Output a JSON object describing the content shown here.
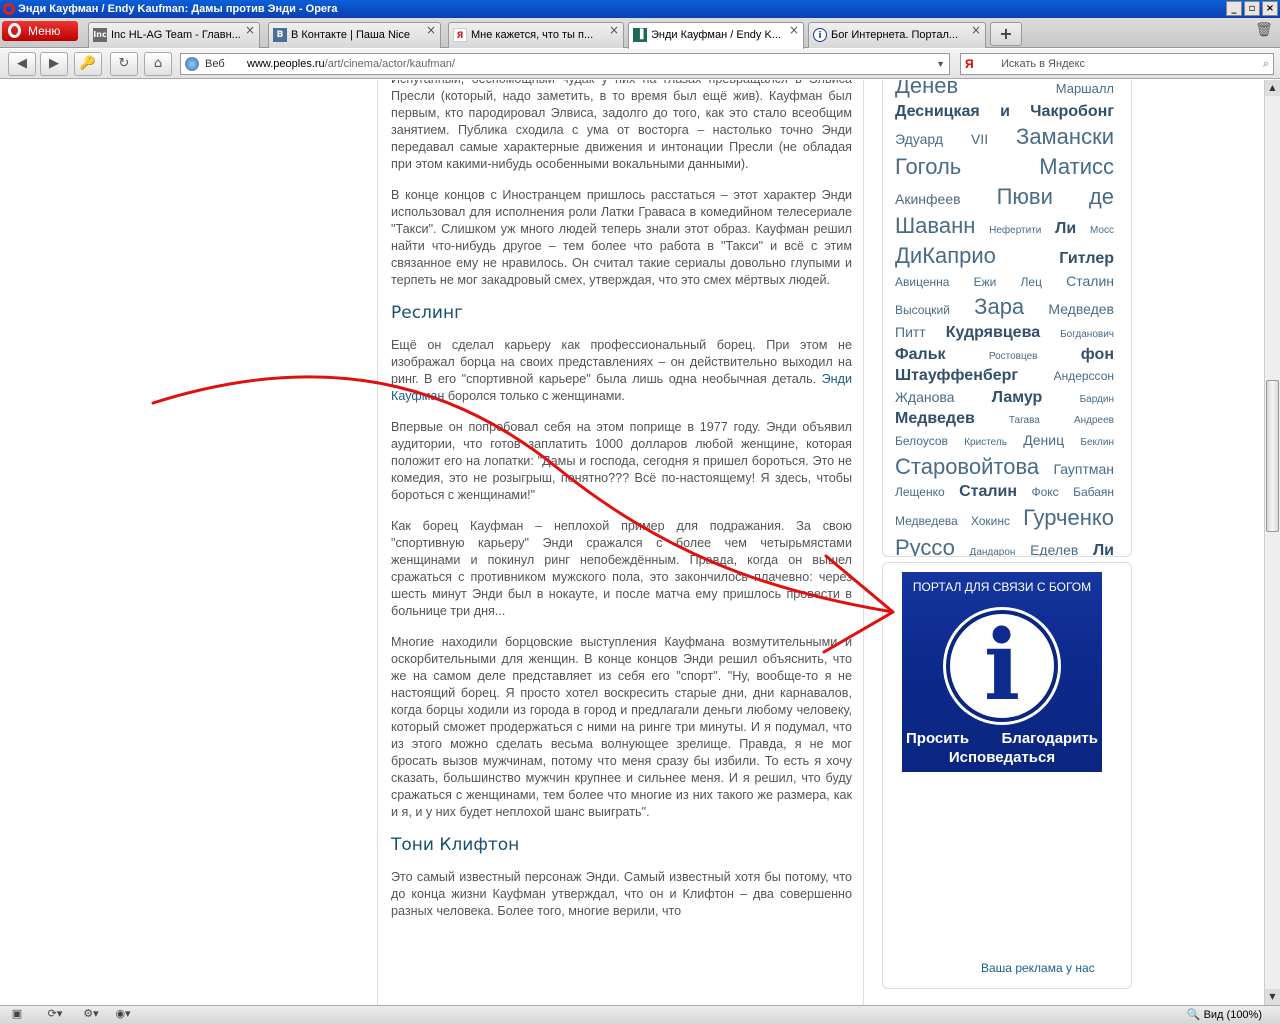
{
  "window": {
    "title": "Энди Кауфман / Endy Kaufman: Дамы против Энди - Opera",
    "min": "_",
    "restore": "▫",
    "close": "×"
  },
  "menu": {
    "label": "Меню"
  },
  "tabs": [
    {
      "icon": "Inc",
      "label": "Inc HL-AG Team - Главн...",
      "color": "#6a6a6a"
    },
    {
      "icon": "B",
      "label": "В Контакте | Паша Nice",
      "color": "#4a6f9a"
    },
    {
      "icon": "Я",
      "label": "Мне кажется, что ты п...",
      "color": "#cc2222"
    },
    {
      "icon": "▐",
      "label": "Энди Кауфман / Endy K...",
      "color": "#1e6a5a",
      "active": true
    },
    {
      "icon": "i",
      "label": "Бог Интернета. Портал...",
      "color": "#1a3a9a"
    }
  ],
  "newtab": "+",
  "nav": {
    "back": "◀",
    "forward": "▶",
    "wand": "🔑",
    "reload": "↻",
    "home": "⌂"
  },
  "address": {
    "web": "Веб",
    "domain": "www.peoples.ru",
    "path": "/art/cinema/actor/kaufman/"
  },
  "search": {
    "engine": "Я",
    "placeholder": "Искать в Яндекс"
  },
  "article": {
    "p0": "Испуганный, беспомощный чудак у них на глазах превращался в Элвиса Пресли (который, надо заметить, в то время был ещё жив). Кауфман был первым, кто пародировал Элвиса, задолго до того, как это стало всеобщим занятием. Публика сходила с ума от восторга – настолько точно Энди передавал самые характерные движения и интонации Пресли (не обладая при этом какими-нибудь особенными вокальными данными).",
    "p1": "В конце концов с Иностранцем пришлось расстаться – этот характер Энди использовал для исполнения роли Латки Граваса в комедийном телесериале \"Такси\". Слишком уж много людей теперь знали этот образ. Кауфман решил найти что-нибудь другое – тем более что работа в \"Такси\" и всё с этим связанное ему не нравилось. Он считал такие сериалы довольно глупыми и терпеть не мог закадровый смех, утверждая, что это смех мёртвых людей.",
    "h1": "Реслинг",
    "p2a": "Ещё он сделал карьеру как профессиональный борец. При этом не изображал борца на своих представлениях – он действительно выходил на ринг. В его \"спортивной карьере\" была лишь одна необычная деталь. ",
    "p2link": "Энди Кауфман",
    "p2b": " боролся только с женщинами.",
    "p3": "Впервые он попробовал себя на этом поприще в 1977 году. Энди объявил аудитории, что готов заплатить 1000 долларов любой женщине, которая положит его на лопатки: \"Дамы и господа, сегодня я пришел бороться. Это не комедия, это не розыгрыш, понятно??? Всё по-настоящему! Я здесь, чтобы бороться с женщинами!\"",
    "p4": "Как борец Кауфман – неплохой пример для подражания. За свою \"спортивную карьеру\" Энди сражался с более чем четырьмястами женщинами и покинул ринг непобеждённым. Правда, когда он вышел сражаться с противником мужского пола, это закончилось плачевно: через шесть минут Энди был в нокауте, и после матча ему пришлось провести в больнице три дня...",
    "p5": "Многие находили борцовские выступления Кауфмана возмутительными и оскорбительными для женщин. В конце концов Энди решил объяснить, что же на самом деле представляет из себя его \"спорт\". \"Ну, вообще-то я не настоящий борец. Я просто хотел воскресить старые дни, дни карнавалов, когда борцы ходили из города в город и предлагали деньги любому человеку, который сможет продержаться с ними на ринге три минуты. И я подумал, что из этого можно сделать весьма волнующее зрелище. Правда, я не мог бросать вызов мужчинам, потому что меня сразу бы избили. То есть я хочу сказать, большинство мужчин крупнее и сильнее меня. И я решил, что буду сражаться с женщинами, тем более что многие из них такого же размера, как и я, и у них будет неплохой шанс выиграть\".",
    "h2": "Тони Клифтон",
    "p6": "Это самый известный персонаж Энди. Самый известный хотя бы потому, что до конца жизни Кауфман утверждал, что он и Клифтон – два совершенно разных человека. Более того, многие верили, что"
  },
  "tags": [
    {
      "t": "Денев",
      "s": 22
    },
    {
      "t": "Маршалл",
      "s": 13
    },
    {
      "t": "Десницкая",
      "s": 16,
      "b": true
    },
    {
      "t": "и",
      "s": 16,
      "b": true
    },
    {
      "t": "Чакробонг",
      "s": 16,
      "b": true
    },
    {
      "t": "Эдуард",
      "s": 14
    },
    {
      "t": "VII",
      "s": 14
    },
    {
      "t": "Замански",
      "s": 22
    },
    {
      "t": "Гоголь",
      "s": 22
    },
    {
      "t": "Матисс",
      "s": 22
    },
    {
      "t": "Акинфеев",
      "s": 14
    },
    {
      "t": "Пюви",
      "s": 22
    },
    {
      "t": "де",
      "s": 22
    },
    {
      "t": "Шаванн",
      "s": 22
    },
    {
      "t": "Нефертити",
      "s": 10
    },
    {
      "t": "Ли",
      "s": 16,
      "b": true
    },
    {
      "t": "Мосс",
      "s": 10
    },
    {
      "t": "ДиКаприо",
      "s": 22
    },
    {
      "t": "Гитлер",
      "s": 16,
      "b": true
    },
    {
      "t": "Авиценна",
      "s": 12
    },
    {
      "t": "Ежи",
      "s": 12
    },
    {
      "t": "Лец",
      "s": 12
    },
    {
      "t": "Сталин",
      "s": 14
    },
    {
      "t": "Высоцкий",
      "s": 12
    },
    {
      "t": "Зара",
      "s": 22
    },
    {
      "t": "Медведев",
      "s": 14
    },
    {
      "t": "Питт",
      "s": 14
    },
    {
      "t": "Кудрявцева",
      "s": 16,
      "b": true
    },
    {
      "t": "Богданович",
      "s": 10
    },
    {
      "t": "Фальк",
      "s": 16,
      "b": true
    },
    {
      "t": "Ростовцев",
      "s": 10
    },
    {
      "t": "фон",
      "s": 16,
      "b": true
    },
    {
      "t": "Штауффенберг",
      "s": 16,
      "b": true
    },
    {
      "t": "Андерссон",
      "s": 12
    },
    {
      "t": "Жданова",
      "s": 14
    },
    {
      "t": "Ламур",
      "s": 16,
      "b": true
    },
    {
      "t": "Бардин",
      "s": 10
    },
    {
      "t": "Медведев",
      "s": 16,
      "b": true
    },
    {
      "t": "Тагава",
      "s": 10
    },
    {
      "t": "Андреев",
      "s": 10
    },
    {
      "t": "Белоусов",
      "s": 12
    },
    {
      "t": "Кристель",
      "s": 10
    },
    {
      "t": "Дениц",
      "s": 14
    },
    {
      "t": "Беклин",
      "s": 10
    },
    {
      "t": "Старовойтова",
      "s": 22
    },
    {
      "t": "Гауптман",
      "s": 14
    },
    {
      "t": "Лещенко",
      "s": 12
    },
    {
      "t": "Сталин",
      "s": 16,
      "b": true
    },
    {
      "t": "Фокс",
      "s": 12
    },
    {
      "t": "Бабаян",
      "s": 12
    },
    {
      "t": "Медведева",
      "s": 12
    },
    {
      "t": "Хокинс",
      "s": 12
    },
    {
      "t": "Гурченко",
      "s": 22
    },
    {
      "t": "Руссо",
      "s": 22
    },
    {
      "t": "Дандарон",
      "s": 10
    },
    {
      "t": "Еделев",
      "s": 14
    },
    {
      "t": "Ли",
      "s": 16,
      "b": true
    }
  ],
  "portal": {
    "title": "ПОРТАЛ ДЛЯ СВЯЗИ С БОГОМ",
    "letter": "i",
    "ask": "Просить",
    "thank": "Благодарить",
    "confess": "Исповедаться"
  },
  "ad": {
    "link": "Ваша реклама у нас"
  },
  "status": {
    "zoom_label": "Вид (100%)"
  },
  "colors": {
    "arrow": "#e01010",
    "heading": "#1b4f70",
    "link": "#1d5f8f"
  }
}
